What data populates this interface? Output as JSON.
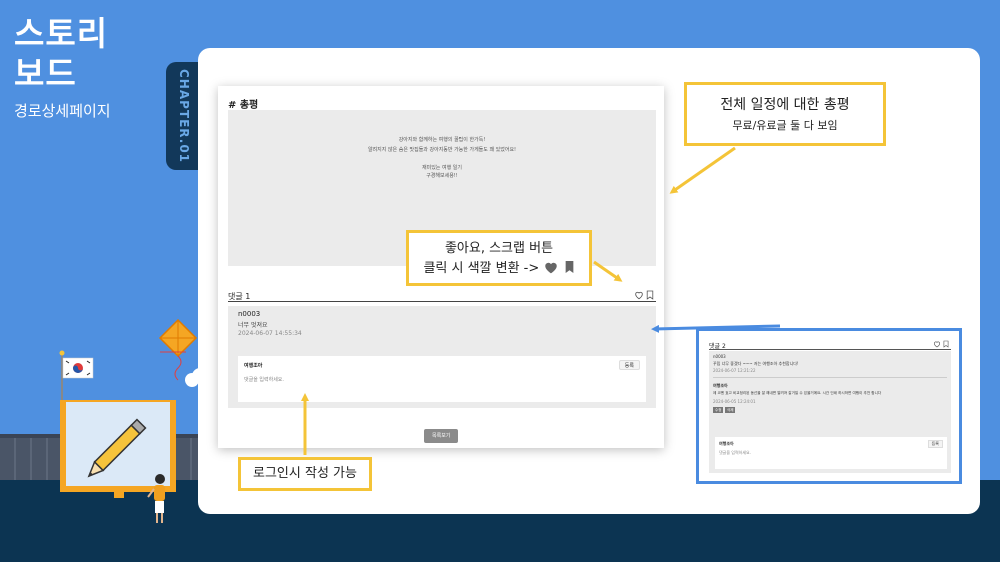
{
  "slide": {
    "title_line1": "스토리",
    "title_line2": "보드",
    "subtitle": "경로상세페이지",
    "chapter": "CHAPTER.01"
  },
  "mockup": {
    "section_heading": "# 총평",
    "review_lines": [
      "강아지와 함께하는 여행의 꿀팁이 한가득!",
      "알려지지 않은 숨은 맛집들과 강아지동반 가능한 가게들도 꽤 있었어요!",
      "재미있는 여행 일기",
      "구경해보세용!!"
    ],
    "comment_section_title": "댓글 1",
    "comment": {
      "user": "n0003",
      "text": "너무 멋져요",
      "date": "2024-06-07 14:55:34"
    },
    "write": {
      "user": "여행조아",
      "placeholder": "댓글을 입력하세요.",
      "submit_label": "등록"
    },
    "list_button_label": "목록보기"
  },
  "inset": {
    "comment_section_title": "댓글 2",
    "comment1": {
      "user": "n0003",
      "text": "꾸밈 너무 좋겠다 ~~~ 저는 여행조아 추천합니다!",
      "date": "2024-06-07 12:21:22"
    },
    "comment2": {
      "user": "여행조아",
      "text": "제 코멘 효고 비교정리된 동선을 잘 해내면 알려져 갈거일 수 있을거에요. 시간 인쇄 하시하면 여행이 추천 합니다",
      "date": "2024-06-05 12:24:01",
      "tags": [
        "수정",
        "삭제"
      ]
    },
    "write": {
      "user": "여행조아",
      "placeholder": "댓글을 입력하세요.",
      "submit_label": "등록"
    }
  },
  "callouts": {
    "review_title": "전체 일정에 대한 총평",
    "review_sub": "무료/유료글 둘 다 보임",
    "like_line1": "좋아요, 스크랩 버튼",
    "like_line2": "클릭 시 색깔 변환 ->",
    "login_note": "로그인시 작성 가능"
  },
  "colors": {
    "background": "#4f90e0",
    "callout_border": "#f4c438",
    "inset_border": "#4a8be0",
    "dark_band": "#0c3452"
  }
}
